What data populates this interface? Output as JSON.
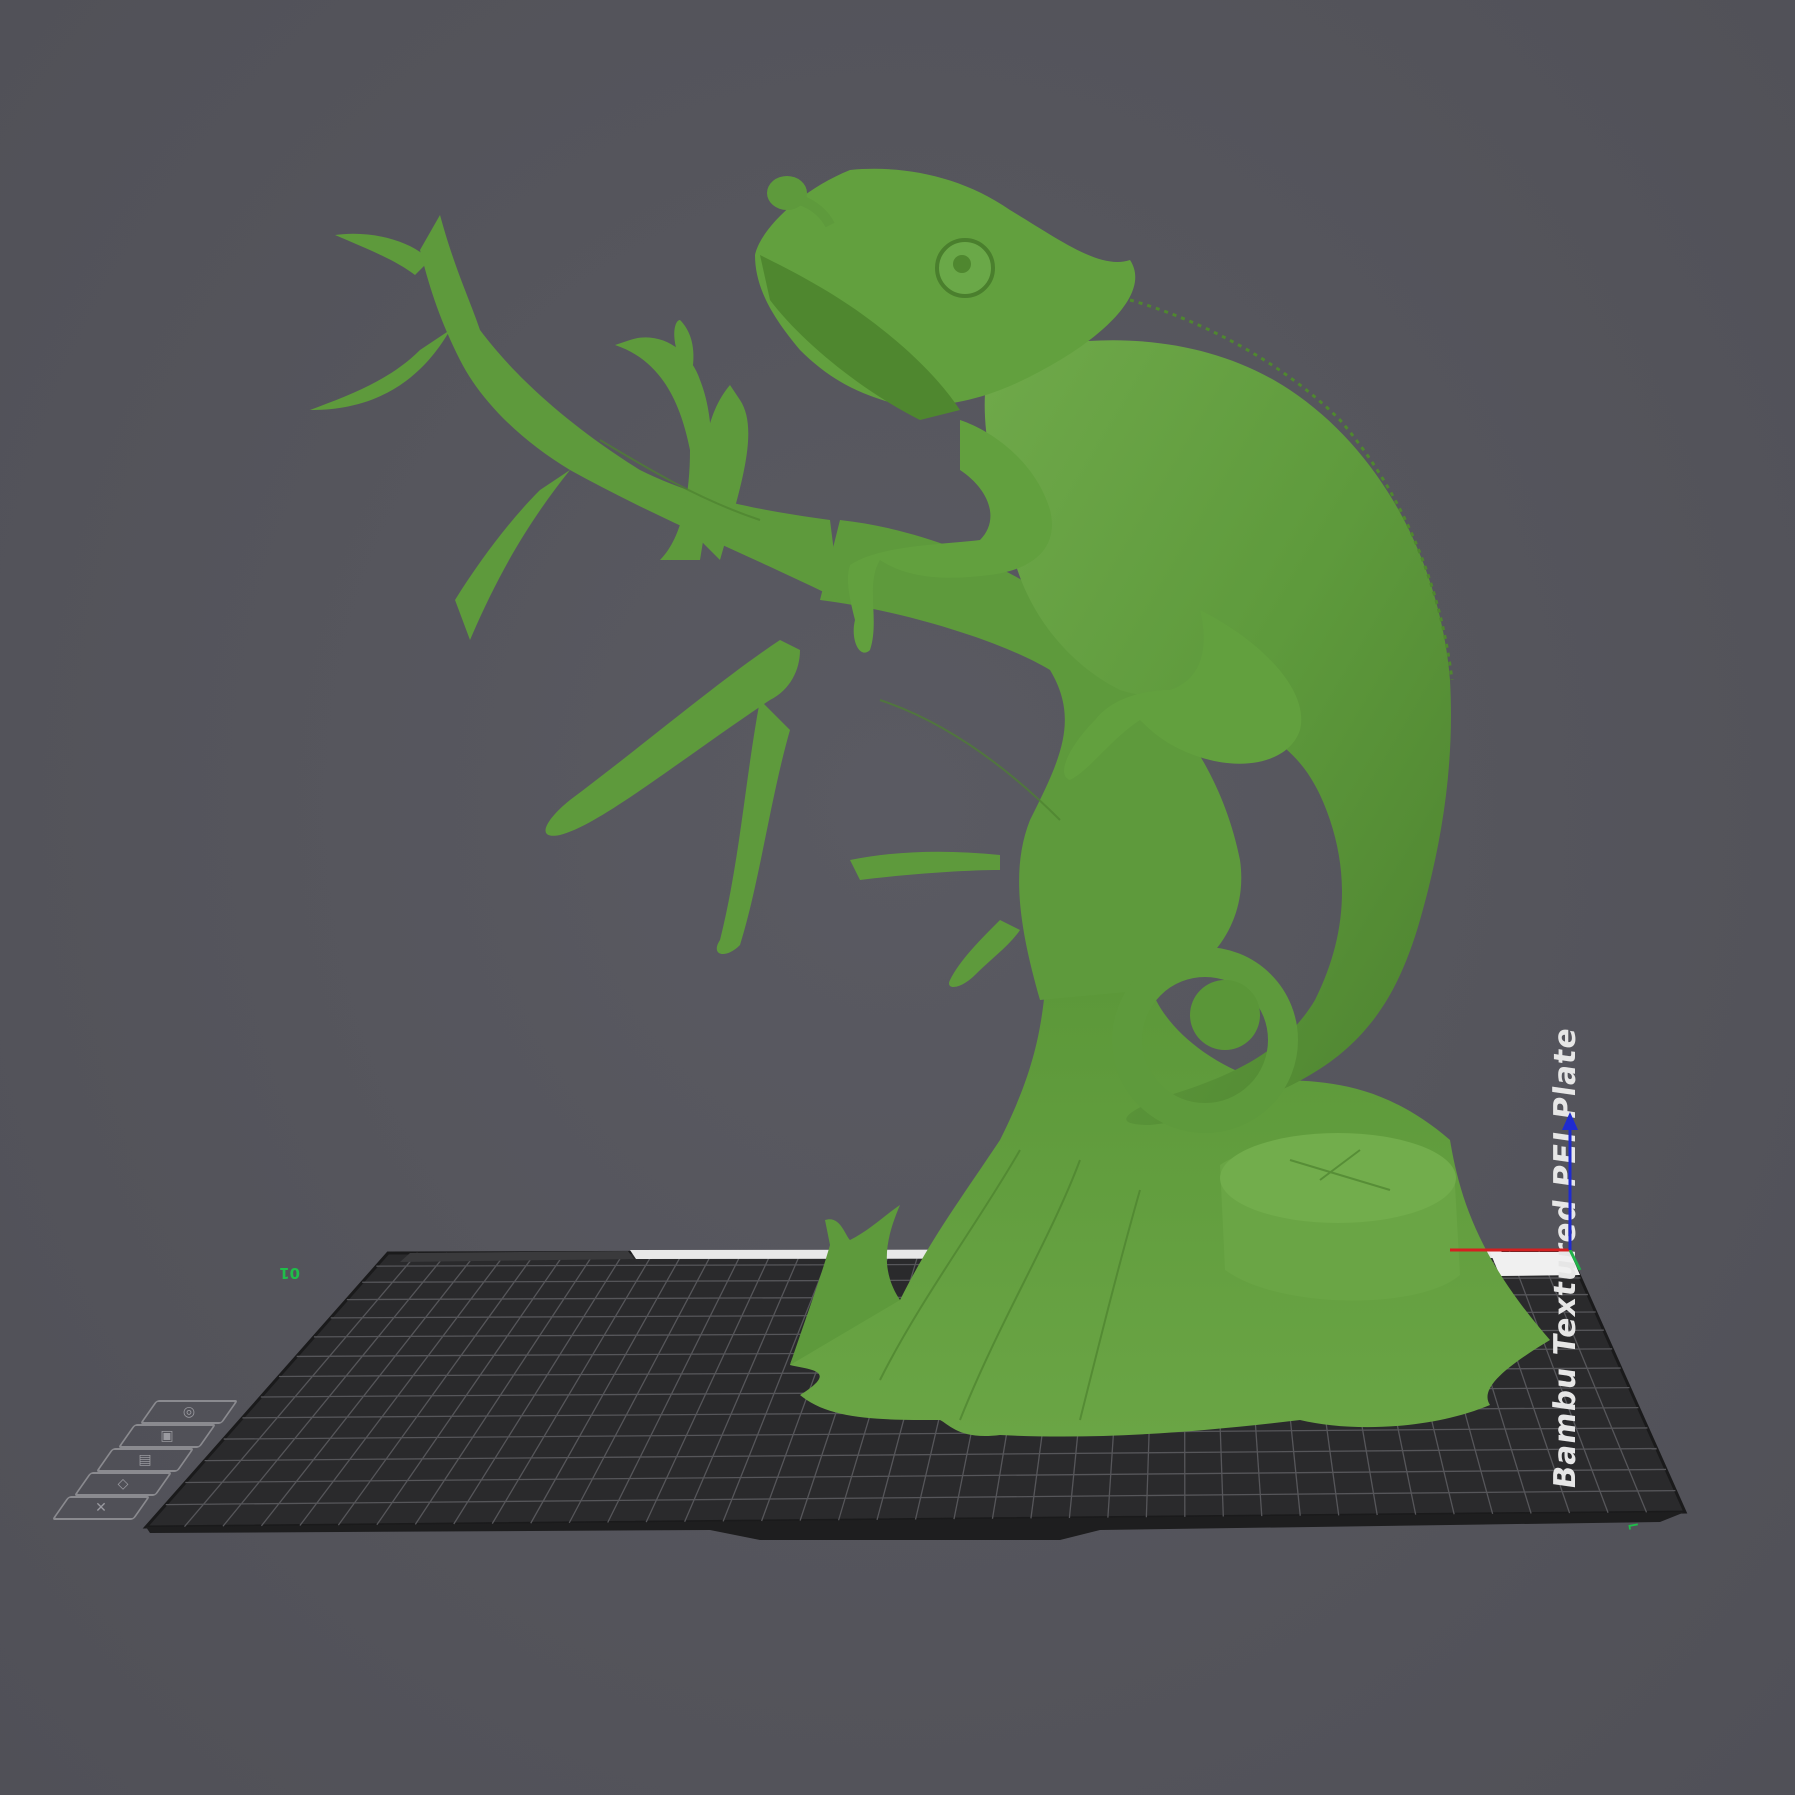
{
  "viewport": {
    "background": "#55555d"
  },
  "build_plate": {
    "label": "Bambu Textured PEI Plate",
    "plate_number": "01",
    "colors": {
      "plate": "#2b2b2d",
      "grid": "#4a4a4c",
      "border_grid": "#6a6a6d"
    }
  },
  "model": {
    "color": "#5e9a3c",
    "shade": "#4a7f2d",
    "highlight": "#74b04f"
  },
  "axes": {
    "x_color": "#d42020",
    "y_color": "#21b24a",
    "z_color": "#1f2bd0"
  },
  "view_buttons": [
    {
      "name": "view-iso-icon",
      "glyph": "◎"
    },
    {
      "name": "view-top-icon",
      "glyph": "▣"
    },
    {
      "name": "view-front-icon",
      "glyph": "▤"
    },
    {
      "name": "view-side-icon",
      "glyph": "◇"
    },
    {
      "name": "view-close-icon",
      "glyph": "✕"
    }
  ]
}
